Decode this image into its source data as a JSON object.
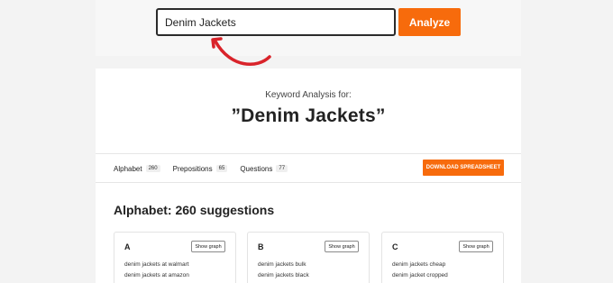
{
  "search": {
    "value": "Denim Jackets",
    "button_label": "Analyze"
  },
  "header": {
    "subtitle": "Keyword Analysis for:",
    "keyword": "”Denim Jackets”"
  },
  "tabs": [
    {
      "label": "Alphabet",
      "count": "260"
    },
    {
      "label": "Prepositions",
      "count": "65"
    },
    {
      "label": "Questions",
      "count": "77"
    }
  ],
  "download_label": "DOWNLOAD SPREADSHEET",
  "section": {
    "heading": "Alphabet: 260 suggestions"
  },
  "letter_cards": [
    {
      "letter": "A",
      "button": "Show graph",
      "suggestions": [
        "denim jackets at walmart",
        "denim jackets at amazon"
      ]
    },
    {
      "letter": "B",
      "button": "Show graph",
      "suggestions": [
        "denim jackets bulk",
        "denim jackets black"
      ]
    },
    {
      "letter": "C",
      "button": "Show graph",
      "suggestions": [
        "denim jackets cheap",
        "denim jacket cropped"
      ]
    }
  ],
  "colors": {
    "accent": "#f76b0c",
    "arrow": "#d9232a"
  }
}
